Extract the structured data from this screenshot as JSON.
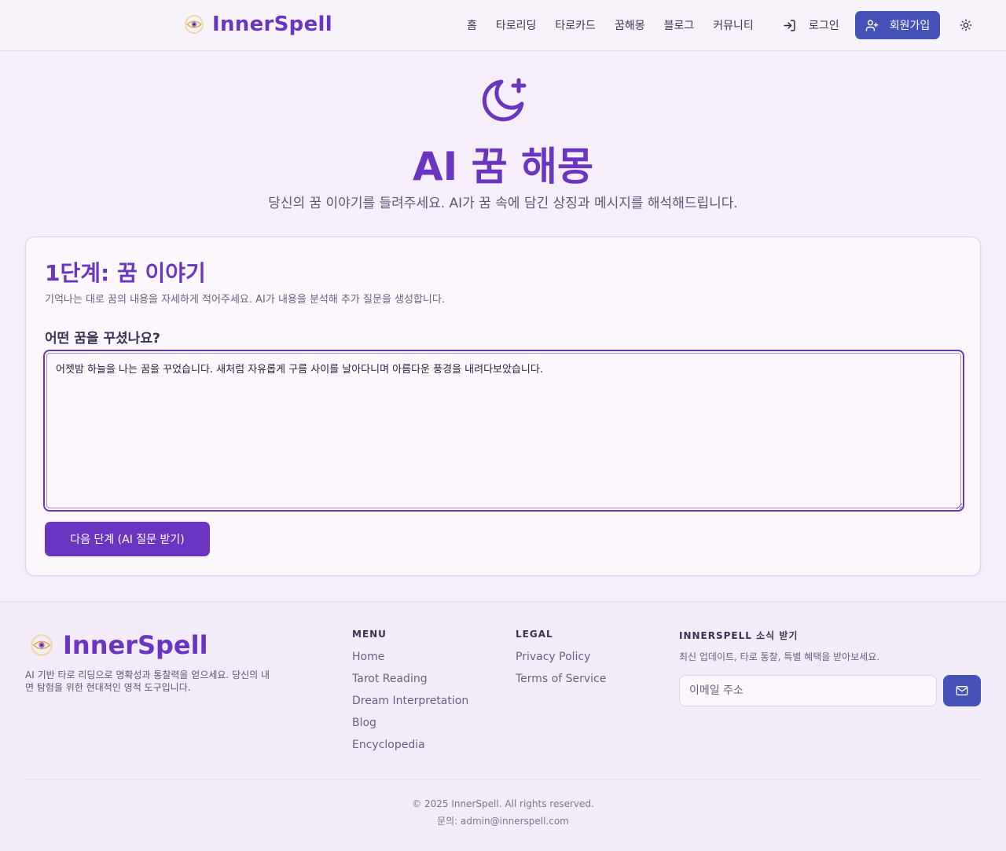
{
  "header": {
    "brand": "InnerSpell",
    "nav": [
      "홈",
      "타로리딩",
      "타로카드",
      "꿈해몽",
      "블로그",
      "커뮤니티"
    ],
    "login_label": "로그인",
    "signup_label": "회원가입"
  },
  "hero": {
    "title": "AI 꿈 해몽",
    "subtitle": "당신의 꿈 이야기를 들려주세요. AI가 꿈 속에 담긴 상징과 메시지를 해석해드립니다."
  },
  "step": {
    "title": "1단계: 꿈 이야기",
    "description": "기억나는 대로 꿈의 내용을 자세하게 적어주세요. AI가 내용을 분석해 추가 질문을 생성합니다.",
    "field_label": "어떤 꿈을 꾸셨나요?",
    "dream_text": "어젯밤 하늘을 나는 꿈을 꾸었습니다. 새처럼 자유롭게 구름 사이를 날아다니며 아름다운 풍경을 내려다보았습니다.",
    "next_button": "다음 단계 (AI 질문 받기)"
  },
  "footer": {
    "brand": "InnerSpell",
    "description": "AI 기반 타로 리딩으로 명확성과 통찰력을 얻으세요. 당신의 내면 탐험을 위한 현대적인 영적 도구입니다.",
    "menu_title": "MENU",
    "menu_links": [
      "Home",
      "Tarot Reading",
      "Dream Interpretation",
      "Blog",
      "Encyclopedia"
    ],
    "legal_title": "LEGAL",
    "legal_links": [
      "Privacy Policy",
      "Terms of Service"
    ],
    "newsletter_title": "INNERSPELL 소식 받기",
    "newsletter_desc": "최신 업데이트, 타로 통찰, 특별 혜택을 받아보세요.",
    "email_placeholder": "이메일 주소",
    "copyright": "© 2025 InnerSpell. All rights reserved.",
    "contact": "문의: admin@innerspell.com"
  },
  "colors": {
    "primary": "#6a35c0",
    "accent_blue": "#4552b8",
    "background": "#f6eefa"
  },
  "icons": [
    "eye-logo-icon",
    "login-icon",
    "user-plus-icon",
    "sun-icon",
    "moon-star-icon",
    "mail-icon"
  ]
}
